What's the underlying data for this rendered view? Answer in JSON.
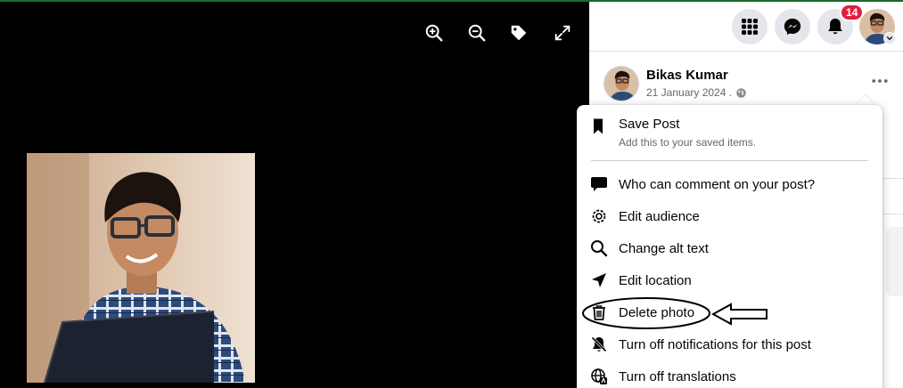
{
  "viewer": {
    "tools": [
      {
        "icon": "zoom-in-icon"
      },
      {
        "icon": "zoom-out-icon"
      },
      {
        "icon": "tag-icon"
      },
      {
        "icon": "fullscreen-icon"
      }
    ]
  },
  "header": {
    "notifications_count": "14",
    "icons": [
      "menu-grid-icon",
      "messenger-icon",
      "bell-icon"
    ]
  },
  "post": {
    "author": "Bikas Kumar",
    "date": "21 January 2024 .",
    "audience_icon": "globe-icon"
  },
  "menu": {
    "save": {
      "title": "Save Post",
      "subtitle": "Add this to your saved items."
    },
    "items": [
      {
        "label": "Who can comment on your post?",
        "icon": "comment-icon"
      },
      {
        "label": "Edit audience",
        "icon": "gear-icon"
      },
      {
        "label": "Change alt text",
        "icon": "search-icon"
      },
      {
        "label": "Edit location",
        "icon": "location-arrow-icon"
      },
      {
        "label": "Delete photo",
        "icon": "trash-icon"
      },
      {
        "label": "Turn off notifications for this post",
        "icon": "bell-off-icon"
      },
      {
        "label": "Turn off translations",
        "icon": "translate-globe-icon"
      }
    ]
  },
  "colors": {
    "badge": "#e41e3f",
    "viewer_bg": "#000000",
    "button_bg": "#e4e6eb"
  }
}
